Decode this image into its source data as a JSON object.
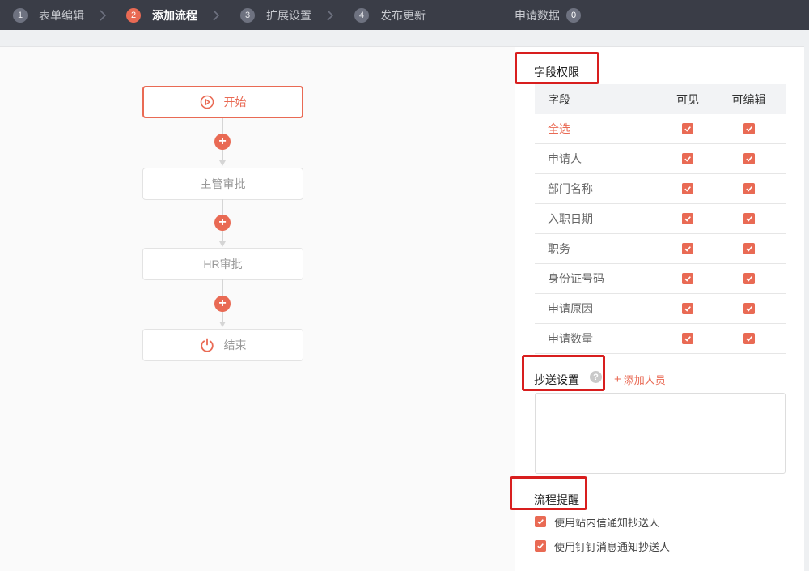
{
  "steps": [
    {
      "num": "1",
      "label": "表单编辑"
    },
    {
      "num": "2",
      "label": "添加流程"
    },
    {
      "num": "3",
      "label": "扩展设置"
    },
    {
      "num": "4",
      "label": "发布更新"
    }
  ],
  "apply_data": {
    "label": "申请数据",
    "count": "0"
  },
  "flow": {
    "nodes": [
      {
        "label": "开始",
        "icon": "play-circle-icon"
      },
      {
        "label": "主管审批"
      },
      {
        "label": "HR审批"
      },
      {
        "label": "结束",
        "icon": "power-icon"
      }
    ]
  },
  "permissions": {
    "title": "字段权限",
    "headers": {
      "field": "字段",
      "visible": "可见",
      "editable": "可编辑"
    },
    "rows": [
      {
        "field": "全选",
        "visible": true,
        "editable": true
      },
      {
        "field": "申请人",
        "visible": true,
        "editable": true
      },
      {
        "field": "部门名称",
        "visible": true,
        "editable": true
      },
      {
        "field": "入职日期",
        "visible": true,
        "editable": true
      },
      {
        "field": "职务",
        "visible": true,
        "editable": true
      },
      {
        "field": "身份证号码",
        "visible": true,
        "editable": true
      },
      {
        "field": "申请原因",
        "visible": true,
        "editable": true
      },
      {
        "field": "申请数量",
        "visible": true,
        "editable": true
      }
    ]
  },
  "cc": {
    "title": "抄送设置",
    "help": "?",
    "add_label": "添加人员"
  },
  "reminders": {
    "title": "流程提醒",
    "items": [
      {
        "label": "使用站内信通知抄送人",
        "checked": true
      },
      {
        "label": "使用钉钉消息通知抄送人",
        "checked": true
      }
    ]
  },
  "colors": {
    "accent": "#e96a54",
    "topbar": "#3a3d47",
    "highlight": "#d81e1e"
  }
}
